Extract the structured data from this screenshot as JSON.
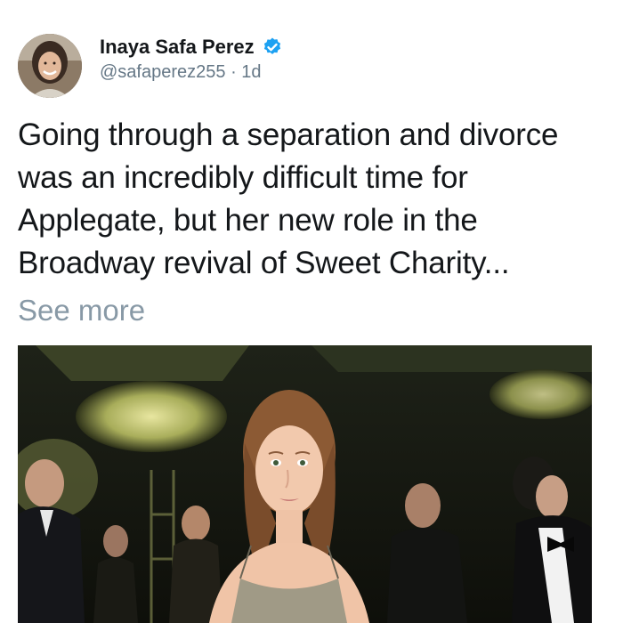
{
  "tweet": {
    "author": {
      "display_name": "Inaya Safa Perez",
      "verified": true,
      "handle": "@safaperez255",
      "separator": "·",
      "age": "1d",
      "avatar_icon": "profile-photo"
    },
    "text": "Going through a separation and divorce was an incredibly difficult time for Applegate, but her new role in the Broadway revival of Sweet Charity...",
    "see_more_label": "See more",
    "media": {
      "type": "photo",
      "description_icon": "event-photo"
    }
  },
  "colors": {
    "verified_blue": "#1da1f2",
    "secondary_text": "#657786",
    "see_more": "#8899a6",
    "primary_text": "#14171a"
  }
}
